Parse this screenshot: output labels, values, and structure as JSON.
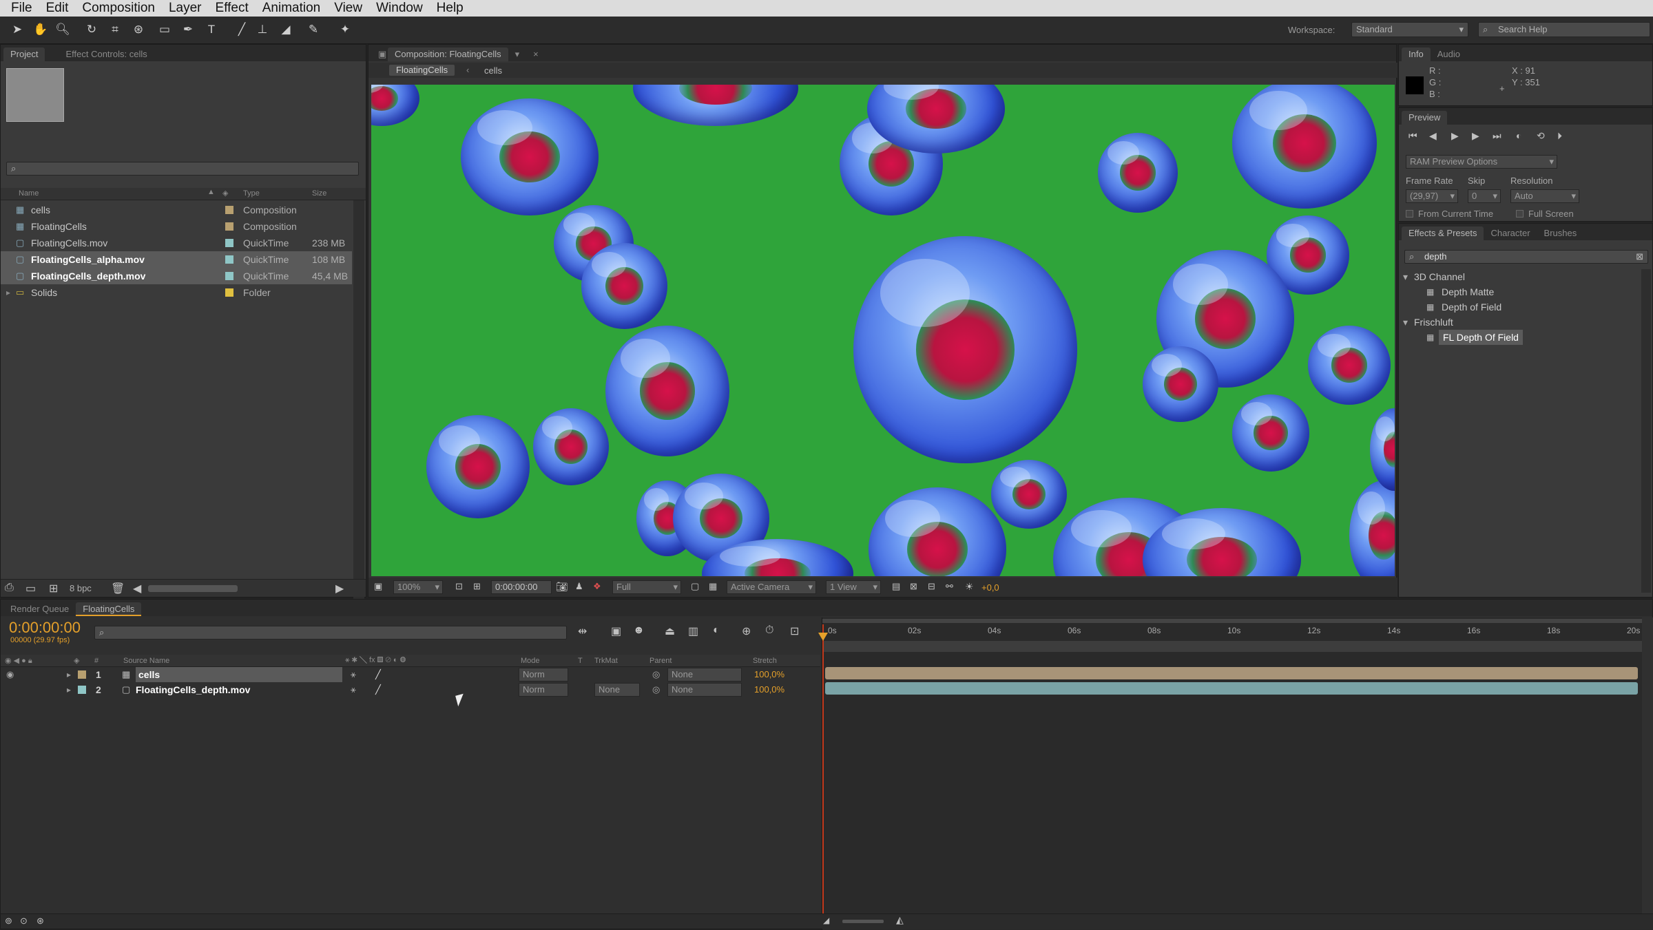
{
  "menu": [
    "File",
    "Edit",
    "Composition",
    "Layer",
    "Effect",
    "Animation",
    "View",
    "Window",
    "Help"
  ],
  "toolbar": {
    "workspace_label": "Workspace:",
    "workspace_value": "Standard",
    "search_placeholder": "Search Help"
  },
  "project_panel": {
    "tabs": [
      "Project",
      "Effect Controls: cells"
    ],
    "columns": {
      "name": "Name",
      "type": "Type",
      "size": "Size"
    },
    "items": [
      {
        "name": "cells",
        "type": "Composition",
        "size": "",
        "color": "#b8a070",
        "bold": false
      },
      {
        "name": "FloatingCells",
        "type": "Composition",
        "size": "",
        "color": "#b8a070",
        "bold": false
      },
      {
        "name": "FloatingCells.mov",
        "type": "QuickTime",
        "size": "238 MB",
        "color": "#8fc6c6",
        "bold": false
      },
      {
        "name": "FloatingCells_alpha.mov",
        "type": "QuickTime",
        "size": "108 MB",
        "color": "#8fc6c6",
        "bold": true
      },
      {
        "name": "FloatingCells_depth.mov",
        "type": "QuickTime",
        "size": "45,4 MB",
        "color": "#8fc6c6",
        "bold": true
      },
      {
        "name": "Solids",
        "type": "Folder",
        "size": "",
        "color": "#e0c040",
        "bold": false
      }
    ],
    "bpc": "8 bpc"
  },
  "composition_panel": {
    "tab": "Composition: FloatingCells",
    "breadcrumb": [
      "FloatingCells",
      "cells"
    ],
    "zoom": "100%",
    "timecode": "0:00:00:00",
    "resolution": "Full",
    "camera": "Active Camera",
    "view": "1 View",
    "exposure": "+0,0"
  },
  "info_panel": {
    "tabs": [
      "Info",
      "Audio"
    ],
    "r": "R :",
    "g": "G :",
    "b": "B :",
    "x": "X : 91",
    "y": "Y : 351"
  },
  "preview_panel": {
    "tab": "Preview",
    "ram_options": "RAM Preview Options",
    "frame_rate_label": "Frame Rate",
    "skip_label": "Skip",
    "resolution_label": "Resolution",
    "frame_rate": "(29,97)",
    "skip": "0",
    "resolution": "Auto",
    "from_current": "From Current Time",
    "full_screen": "Full Screen"
  },
  "effects_panel": {
    "tabs": [
      "Effects & Presets",
      "Character",
      "Brushes"
    ],
    "search_value": "depth",
    "groups": [
      {
        "name": "3D Channel",
        "items": [
          "Depth Matte",
          "Depth of Field"
        ]
      },
      {
        "name": "Frischluft",
        "items": [
          "FL Depth Of Field"
        ]
      }
    ]
  },
  "timeline": {
    "tabs": [
      "Render Queue",
      "FloatingCells"
    ],
    "timecode": "0:00:00:00",
    "fps": "00000 (29.97 fps)",
    "columns": {
      "num": "#",
      "source": "Source Name",
      "mode": "Mode",
      "t": "T",
      "trkmat": "TrkMat",
      "parent": "Parent",
      "stretch": "Stretch"
    },
    "layers": [
      {
        "num": "1",
        "name": "cells",
        "mode": "Norm",
        "trkmat": "",
        "parent": "None",
        "stretch": "100,0%",
        "color": "#b8a070",
        "bar": "#a89478"
      },
      {
        "num": "2",
        "name": "FloatingCells_depth.mov",
        "mode": "Norm",
        "trkmat": "None",
        "parent": "None",
        "stretch": "100,0%",
        "color": "#8fc6c6",
        "bar": "#7aa3a6"
      }
    ],
    "ruler": [
      "0s",
      "02s",
      "04s",
      "06s",
      "08s",
      "10s",
      "12s",
      "14s",
      "16s",
      "18s",
      "20s"
    ]
  }
}
